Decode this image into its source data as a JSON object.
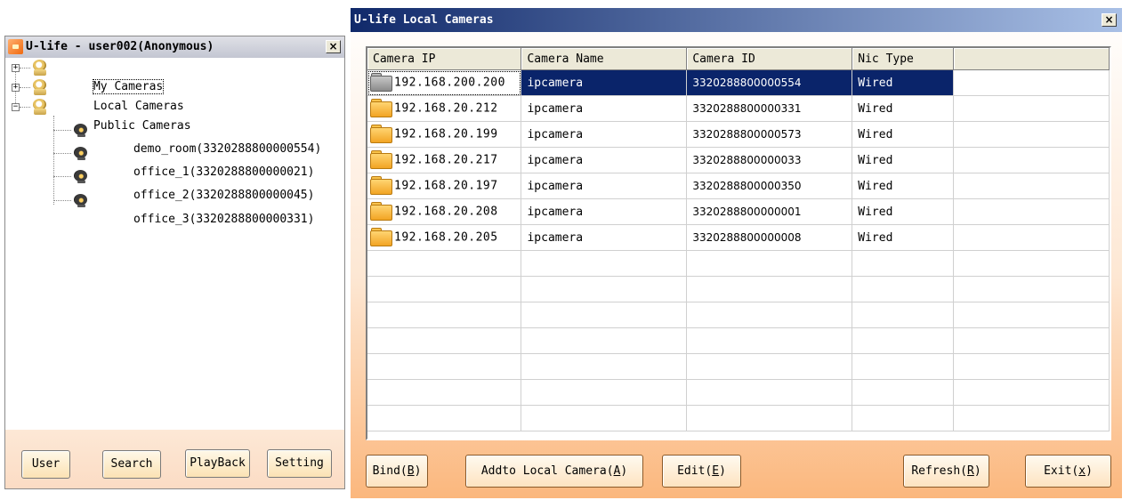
{
  "left_window": {
    "title": "U-life - user002(Anonymous)",
    "close": "×",
    "tree": {
      "my_cameras": "My Cameras",
      "local_cameras": "Local Cameras",
      "public_cameras": "Public Cameras",
      "public_items": [
        "demo_room(3320288800000554)",
        "office_1(3320288800000021)",
        "office_2(3320288800000045)",
        "office_3(3320288800000331)"
      ]
    },
    "buttons": {
      "user": "User",
      "search": "Search",
      "playback": "PlayBack",
      "setting": "Setting"
    }
  },
  "right_window": {
    "title": "U-life Local Cameras",
    "close": "×",
    "columns": [
      "Camera IP",
      "Camera Name",
      "Camera ID",
      "Nic Type"
    ],
    "rows": [
      {
        "ip": "192.168.200.200",
        "name": "ipcamera",
        "id": "3320288800000554",
        "nic": "Wired"
      },
      {
        "ip": "192.168.20.212",
        "name": "ipcamera",
        "id": "3320288800000331",
        "nic": "Wired"
      },
      {
        "ip": "192.168.20.199",
        "name": "ipcamera",
        "id": "3320288800000573",
        "nic": "Wired"
      },
      {
        "ip": "192.168.20.217",
        "name": "ipcamera",
        "id": "3320288800000033",
        "nic": "Wired"
      },
      {
        "ip": "192.168.20.197",
        "name": "ipcamera",
        "id": "3320288800000350",
        "nic": "Wired"
      },
      {
        "ip": "192.168.20.208",
        "name": "ipcamera",
        "id": "3320288800000001",
        "nic": "Wired"
      },
      {
        "ip": "192.168.20.205",
        "name": "ipcamera",
        "id": "3320288800000008",
        "nic": "Wired"
      }
    ],
    "buttons": {
      "bind": {
        "text": "Bind(",
        "key": "B",
        "end": ")"
      },
      "add": {
        "text": "Addto Local Camera(",
        "key": "A",
        "end": ")"
      },
      "edit": {
        "text": "Edit(",
        "key": "E",
        "end": ")"
      },
      "refresh": {
        "text": "Refresh(",
        "key": "R",
        "end": ")"
      },
      "exit": {
        "text": "Exit(",
        "key": "x",
        "end": ")"
      }
    }
  }
}
